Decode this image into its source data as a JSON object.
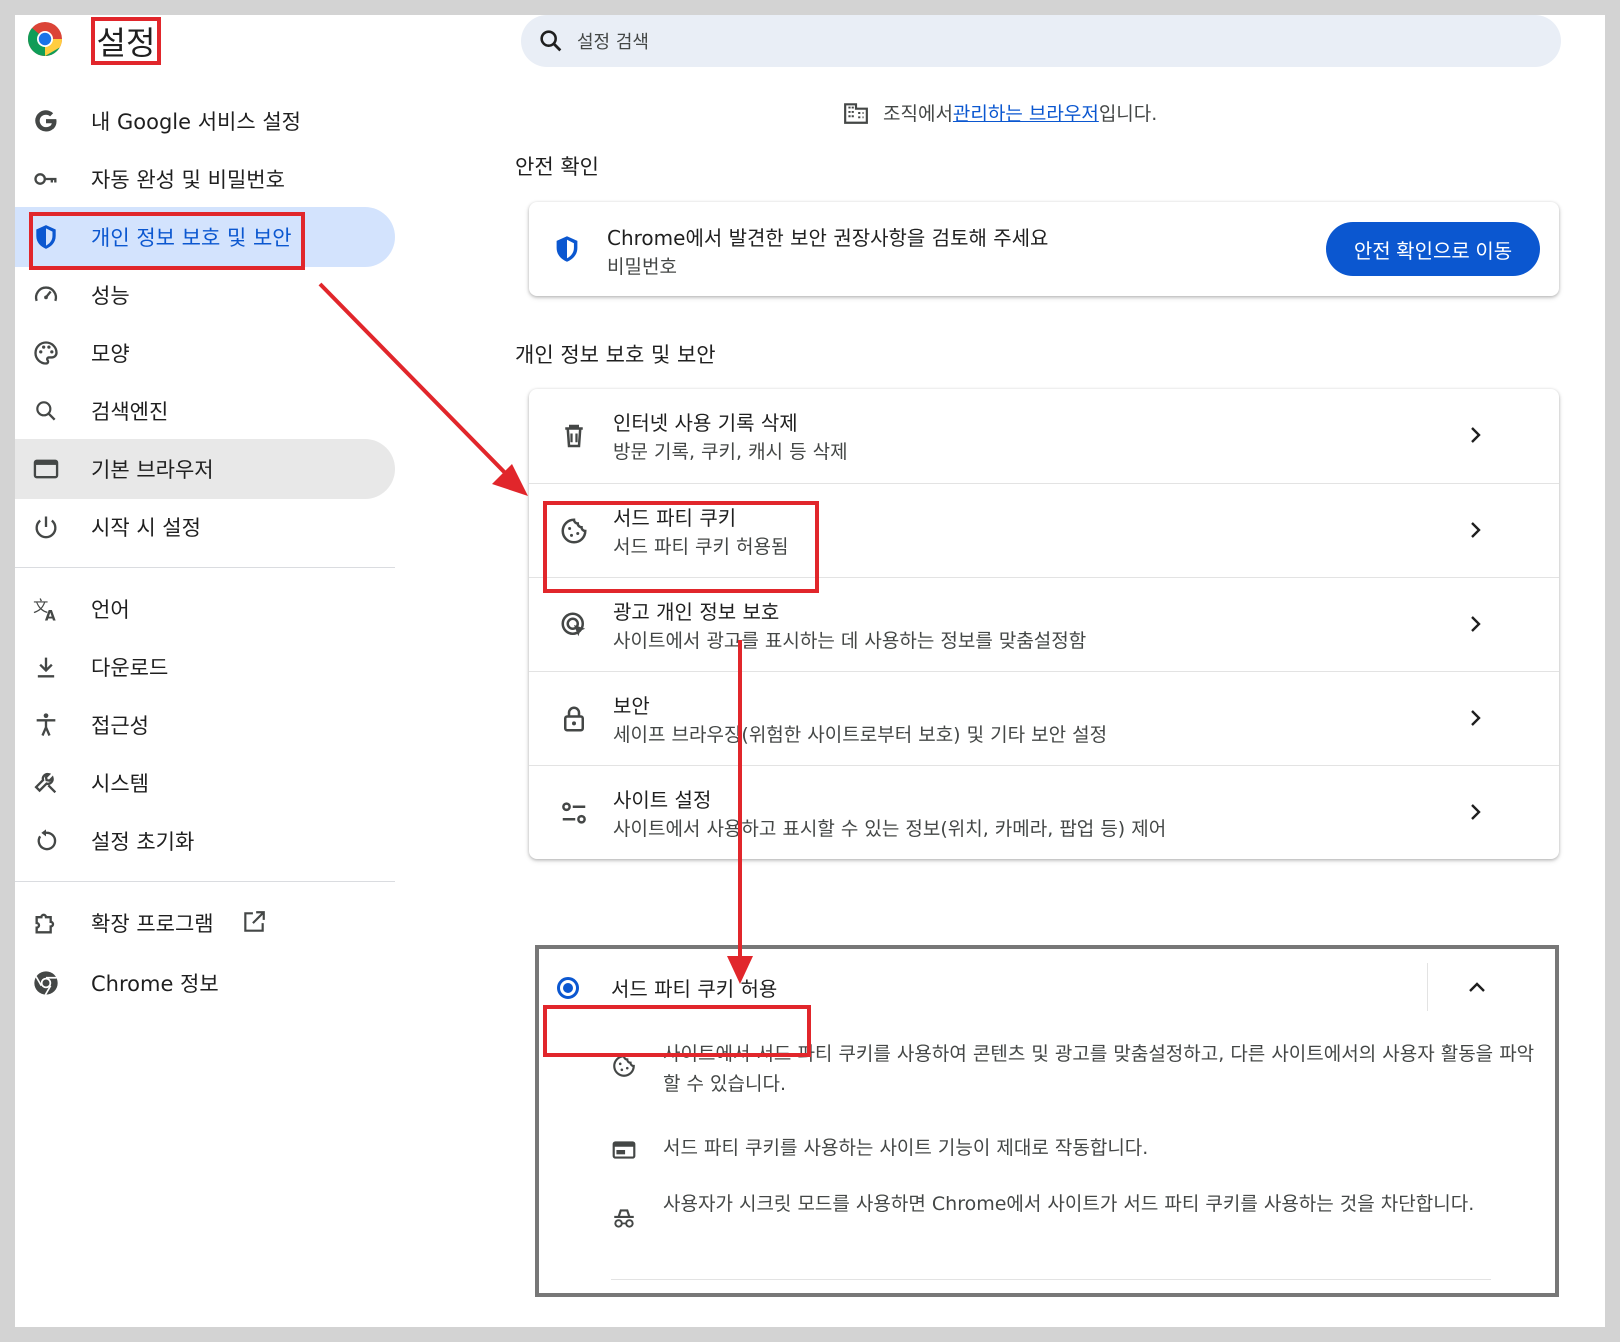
{
  "header": {
    "title": "설정",
    "search_placeholder": "설정 검색"
  },
  "sidebar": {
    "items": [
      {
        "label": "내 Google 서비스 설정",
        "icon": "google-icon"
      },
      {
        "label": "자동 완성 및 비밀번호",
        "icon": "key-icon"
      },
      {
        "label": "개인 정보 보호 및 보안",
        "icon": "shield-icon",
        "active": true
      },
      {
        "label": "성능",
        "icon": "speedometer-icon"
      },
      {
        "label": "모양",
        "icon": "palette-icon"
      },
      {
        "label": "검색엔진",
        "icon": "search-icon"
      },
      {
        "label": "기본 브라우저",
        "icon": "browser-window-icon"
      },
      {
        "label": "시작 시 설정",
        "icon": "power-icon"
      },
      {
        "label": "언어",
        "icon": "translate-icon"
      },
      {
        "label": "다운로드",
        "icon": "download-icon"
      },
      {
        "label": "접근성",
        "icon": "accessibility-icon"
      },
      {
        "label": "시스템",
        "icon": "wrench-icon"
      },
      {
        "label": "설정 초기화",
        "icon": "reset-icon"
      },
      {
        "label": "확장 프로그램",
        "icon": "puzzle-icon"
      },
      {
        "label": "Chrome 정보",
        "icon": "chrome-icon"
      }
    ]
  },
  "managed": {
    "prefix": "조직에서 ",
    "link": "관리하는 브라우저",
    "suffix": "입니다."
  },
  "safety_check": {
    "section_title": "안전 확인",
    "title": "Chrome에서 발견한 보안 권장사항을 검토해 주세요",
    "subtitle": "비밀번호",
    "button": "안전 확인으로 이동"
  },
  "privacy": {
    "section_title": "개인 정보 보호 및 보안",
    "rows": [
      {
        "title": "인터넷 사용 기록 삭제",
        "subtitle": "방문 기록, 쿠키, 캐시 등 삭제",
        "icon": "trash-icon"
      },
      {
        "title": "서드 파티 쿠키",
        "subtitle": "서드 파티 쿠키 허용됨",
        "icon": "cookie-icon"
      },
      {
        "title": "광고 개인 정보 보호",
        "subtitle": "사이트에서 광고를 표시하는 데 사용하는 정보를 맞춤설정함",
        "icon": "ad-privacy-icon"
      },
      {
        "title": "보안",
        "subtitle": "세이프 브라우징(위험한 사이트로부터 보호) 및 기타 보안 설정",
        "icon": "lock-icon"
      },
      {
        "title": "사이트 설정",
        "subtitle": "사이트에서 사용하고 표시할 수 있는 정보(위치, 카메라, 팝업 등) 제어",
        "icon": "tune-icon"
      }
    ]
  },
  "cookie_option": {
    "label": "서드 파티 쿠키 허용",
    "selected": true,
    "details": [
      {
        "icon": "cookie-icon",
        "text": "사이트에서 서드 파티 쿠키를 사용하여 콘텐츠 및 광고를 맞춤설정하고, 다른 사이트에서의 사용자 활동을 파악할 수 있습니다."
      },
      {
        "icon": "web-feature-icon",
        "text": "서드 파티 쿠키를 사용하는 사이트 기능이 제대로 작동합니다."
      },
      {
        "icon": "incognito-icon",
        "text": "사용자가 시크릿 모드를 사용하면 Chrome에서 사이트가 서드 파티 쿠키를 사용하는 것을 차단합니다."
      }
    ]
  },
  "colors": {
    "accent": "#0b57d0",
    "highlight": "#e1262b",
    "active_bg": "#d3e3fd"
  }
}
